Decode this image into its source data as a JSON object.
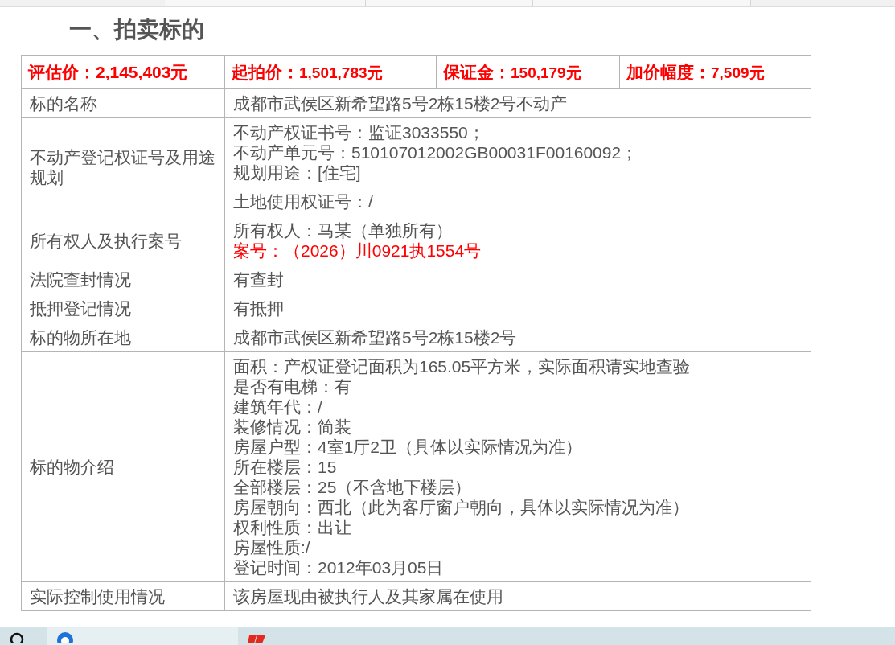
{
  "heading": "一、拍卖标的",
  "prices": [
    {
      "label": "评估价：",
      "value": "2,145,403元"
    },
    {
      "label": "起拍价：",
      "value": "1,501,783元"
    },
    {
      "label": "保证金：",
      "value": "150,179元"
    },
    {
      "label": "加价幅度：",
      "value": "7,509元"
    }
  ],
  "rows": [
    {
      "label": "标的名称",
      "cells": [
        {
          "lines": [
            {
              "text": "成都市武侯区新希望路5号2栋15楼2号不动产",
              "kind": "normal"
            }
          ]
        }
      ]
    },
    {
      "label": "不动产登记权证号及用途规划",
      "cells": [
        {
          "lines": [
            {
              "text": "不动产权证书号：监证3033550；",
              "kind": "normal"
            },
            {
              "text": "不动产单元号：510107012002GB00031F00160092；",
              "kind": "normal"
            },
            {
              "text": "规划用途：[住宅]",
              "kind": "normal"
            }
          ]
        },
        {
          "lines": [
            {
              "text": "土地使用权证号：/",
              "kind": "normal"
            }
          ]
        }
      ]
    },
    {
      "label": "所有权人及执行案号",
      "cells": [
        {
          "lines": [
            {
              "text": "所有权人：马某（单独所有）",
              "kind": "normal"
            },
            {
              "text": "案号：（2026）川0921执1554号",
              "kind": "highlight"
            }
          ]
        }
      ]
    },
    {
      "label": "法院查封情况",
      "cells": [
        {
          "lines": [
            {
              "text": "有查封",
              "kind": "normal"
            }
          ]
        }
      ]
    },
    {
      "label": "抵押登记情况",
      "cells": [
        {
          "lines": [
            {
              "text": "有抵押",
              "kind": "normal"
            }
          ]
        }
      ]
    },
    {
      "label": "标的物所在地",
      "cells": [
        {
          "lines": [
            {
              "text": "成都市武侯区新希望路5号2栋15楼2号",
              "kind": "normal"
            }
          ]
        }
      ]
    },
    {
      "label": "标的物介绍",
      "cells": [
        {
          "lines": [
            {
              "text": "面积：产权证登记面积为165.05平方米，实际面积请实地查验",
              "kind": "normal"
            },
            {
              "text": "是否有电梯：有",
              "kind": "normal"
            },
            {
              "text": "建筑年代：/",
              "kind": "normal"
            },
            {
              "text": "装修情况：简装",
              "kind": "normal"
            },
            {
              "text": "房屋户型：4室1厅2卫（具体以实际情况为准）",
              "kind": "normal"
            },
            {
              "text": "所在楼层：15",
              "kind": "normal"
            },
            {
              "text": "全部楼层：25（不含地下楼层）",
              "kind": "normal"
            },
            {
              "text": "房屋朝向：西北（此为客厅窗户朝向，具体以实际情况为准）",
              "kind": "normal"
            },
            {
              "text": "权利性质：出让",
              "kind": "normal"
            },
            {
              "text": "房屋性质:/",
              "kind": "normal"
            },
            {
              "text": "登记时间：2012年03月05日",
              "kind": "normal"
            }
          ]
        }
      ]
    },
    {
      "label": "实际控制使用情况",
      "cells": [
        {
          "lines": [
            {
              "text": "该房屋现由被执行人及其家属在使用",
              "kind": "normal"
            }
          ]
        }
      ]
    }
  ]
}
